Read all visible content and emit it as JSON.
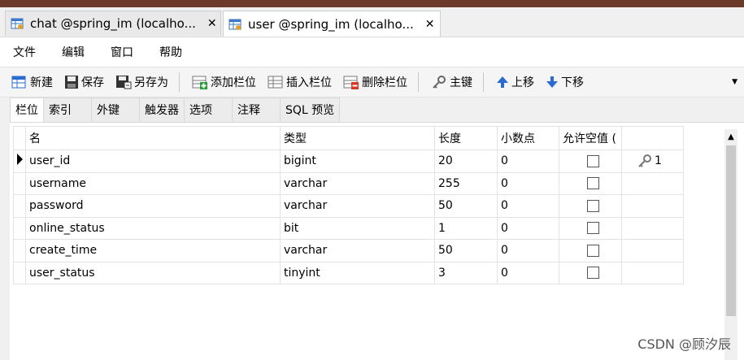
{
  "tabs": [
    {
      "label": "chat @spring_im (localho...",
      "close": "✕"
    },
    {
      "label": "user @spring_im (localho...",
      "close": "✕"
    }
  ],
  "menu": [
    "文件",
    "编辑",
    "窗口",
    "帮助"
  ],
  "toolbar": {
    "new": "新建",
    "save": "保存",
    "save_as": "另存为",
    "add_field": "添加栏位",
    "insert_field": "插入栏位",
    "delete_field": "删除栏位",
    "primary_key": "主键",
    "move_up": "上移",
    "move_down": "下移"
  },
  "subtabs": [
    "栏位",
    "索引",
    "外键",
    "触发器",
    "选项",
    "注释",
    "SQL 预览"
  ],
  "grid": {
    "headers": [
      "名",
      "类型",
      "长度",
      "小数点",
      "允许空值 (",
      ""
    ],
    "rows": [
      {
        "name": "user_id",
        "type": "bigint",
        "length": "20",
        "decimals": "0",
        "nullable": false,
        "key": "1"
      },
      {
        "name": "username",
        "type": "varchar",
        "length": "255",
        "decimals": "0",
        "nullable": false,
        "key": ""
      },
      {
        "name": "password",
        "type": "varchar",
        "length": "50",
        "decimals": "0",
        "nullable": false,
        "key": ""
      },
      {
        "name": "online_status",
        "type": "bit",
        "length": "1",
        "decimals": "0",
        "nullable": false,
        "key": ""
      },
      {
        "name": "create_time",
        "type": "varchar",
        "length": "50",
        "decimals": "0",
        "nullable": false,
        "key": ""
      },
      {
        "name": "user_status",
        "type": "tinyint",
        "length": "3",
        "decimals": "0",
        "nullable": false,
        "key": ""
      }
    ]
  },
  "watermark": "CSDN @顾汐辰",
  "icons": {
    "tab": "table-icon",
    "new": "new-table-icon",
    "save": "save-icon",
    "save_as": "save-as-icon",
    "add_field": "add-field-icon",
    "insert_field": "insert-field-icon",
    "delete_field": "delete-field-icon",
    "primary_key": "key-icon",
    "move_up": "arrow-up-icon",
    "move_down": "arrow-down-icon"
  },
  "colors": {
    "title_strip": "#6b3a2a",
    "arrow_blue": "#2a6bd1",
    "delete_red": "#d23a2a"
  }
}
